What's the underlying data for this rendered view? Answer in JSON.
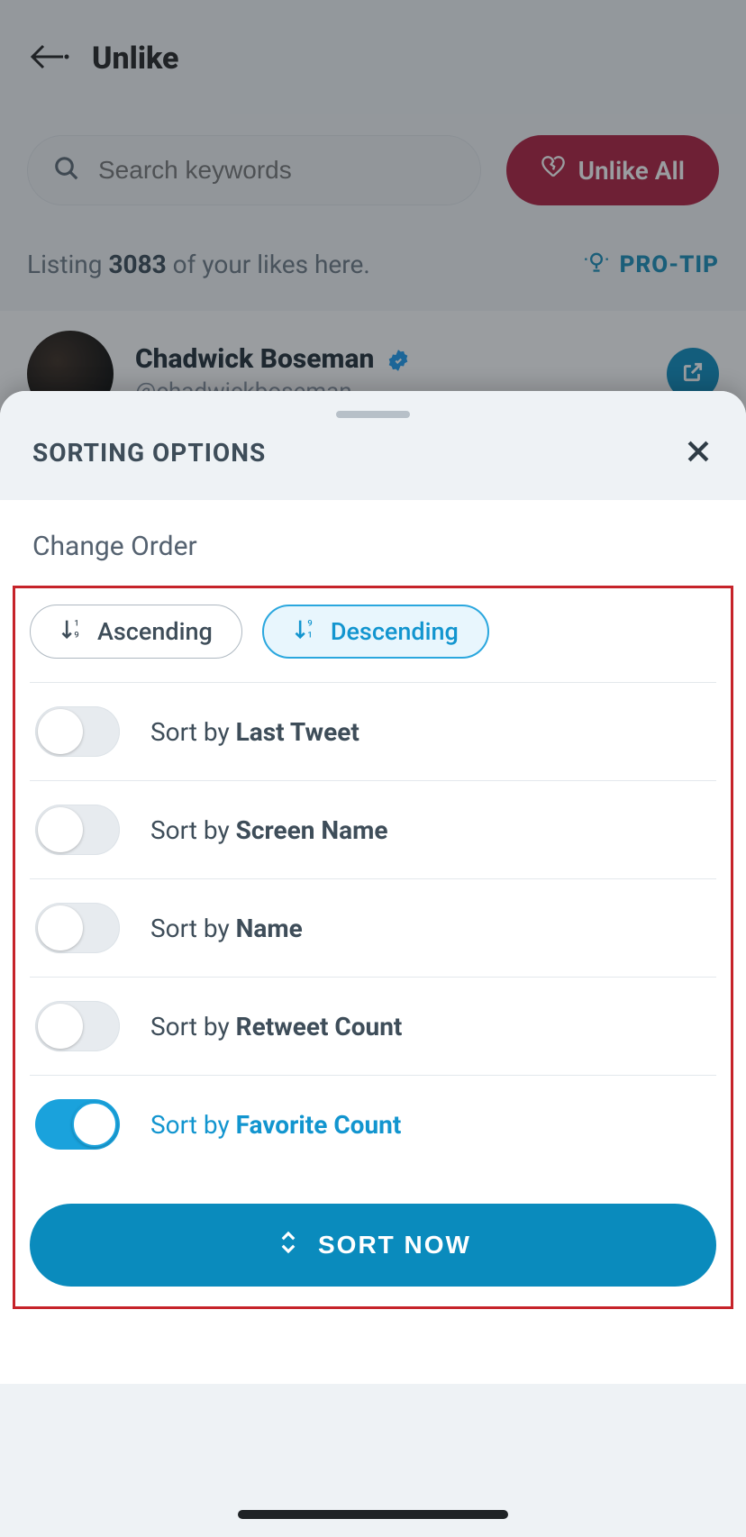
{
  "header": {
    "title": "Unlike"
  },
  "search": {
    "placeholder": "Search keywords"
  },
  "actions": {
    "unlike_all": "Unlike All"
  },
  "listing": {
    "prefix": "Listing",
    "count": "3083",
    "suffix": "of your likes here.",
    "pro_tip": "PRO-TIP"
  },
  "card": {
    "name": "Chadwick Boseman",
    "handle": "@chadwickboseman"
  },
  "sheet": {
    "title": "SORTING OPTIONS",
    "change_order": "Change Order",
    "order": {
      "ascending": "Ascending",
      "descending": "Descending",
      "selected": "descending"
    },
    "sort_options": [
      {
        "prefix": "Sort by ",
        "field": "Last Tweet",
        "on": false
      },
      {
        "prefix": "Sort by ",
        "field": "Screen Name",
        "on": false
      },
      {
        "prefix": "Sort by ",
        "field": "Name",
        "on": false
      },
      {
        "prefix": "Sort by ",
        "field": "Retweet Count",
        "on": false
      },
      {
        "prefix": "Sort by ",
        "field": "Favorite Count",
        "on": true
      }
    ],
    "sort_now": "SORT NOW"
  }
}
